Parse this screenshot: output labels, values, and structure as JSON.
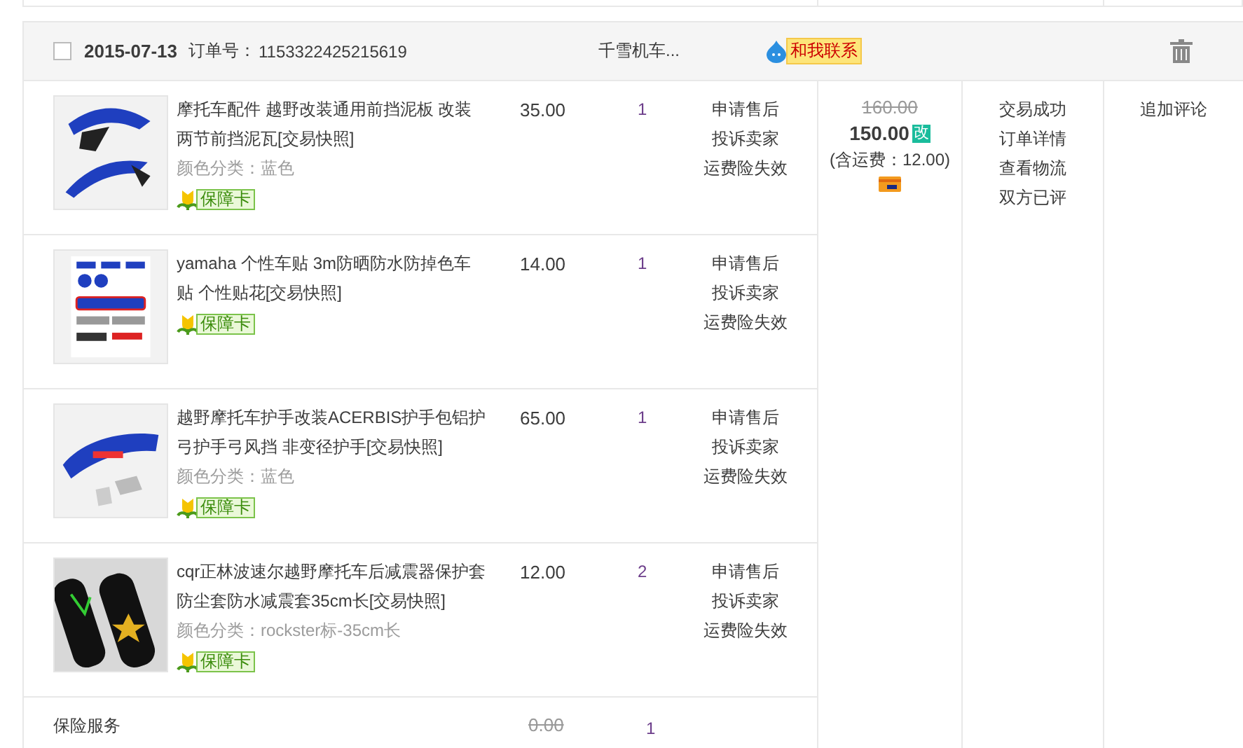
{
  "order": {
    "checked": false,
    "date": "2015-07-13",
    "order_no_label": "订单号：",
    "order_no": "1153322425215619",
    "seller": "千雪机车...",
    "contact": "和我联系",
    "items": [
      {
        "title": "摩托车配件 越野改装通用前挡泥板 改装两节前挡泥瓦",
        "snapshot": "[交易快照]",
        "variant": "颜色分类：蓝色",
        "guarantee": "保障卡",
        "price": "35.00",
        "qty": "1",
        "services": [
          "申请售后",
          "投诉卖家",
          "运费险失效"
        ]
      },
      {
        "title": "yamaha 个性车贴 3m防晒防水防掉色车贴 个性贴花",
        "snapshot": "[交易快照]",
        "guarantee": "保障卡",
        "price": "14.00",
        "qty": "1",
        "services": [
          "申请售后",
          "投诉卖家",
          "运费险失效"
        ]
      },
      {
        "title": "越野摩托车护手改装ACERBIS护手包铝护弓护手弓风挡 非变径护手",
        "snapshot": "[交易快照]",
        "variant": "颜色分类：蓝色",
        "guarantee": "保障卡",
        "price": "65.00",
        "qty": "1",
        "services": [
          "申请售后",
          "投诉卖家",
          "运费险失效"
        ]
      },
      {
        "title": "cqr正林波速尔越野摩托车后减震器保护套防尘套防水减震套35cm长",
        "snapshot": "[交易快照]",
        "variant": "颜色分类：rockster标-35cm长",
        "guarantee": "保障卡",
        "price": "12.00",
        "qty": "2",
        "services": [
          "申请售后",
          "投诉卖家",
          "运费险失效"
        ]
      }
    ],
    "insurance": {
      "label": "保险服务",
      "price": "0.00",
      "qty": "1"
    },
    "original_total": "160.00",
    "total": "150.00",
    "edit_badge": "改",
    "shipping": "(含运费：12.00)",
    "status": [
      "交易成功",
      "订单详情",
      "查看物流",
      "双方已评"
    ],
    "action": "追加评论"
  }
}
